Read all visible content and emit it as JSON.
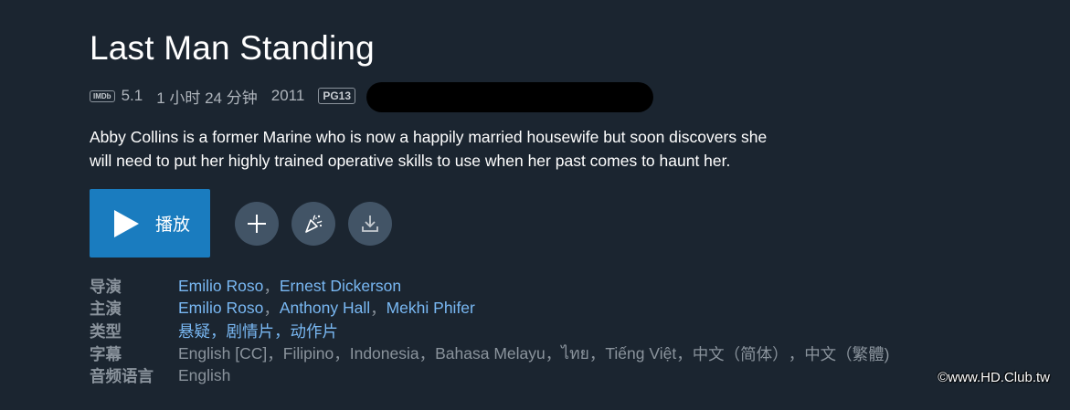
{
  "title": "Last Man Standing",
  "meta": {
    "imdb_badge": "IMDb",
    "imdb_score": "5.1",
    "duration": "1 小时 24 分钟",
    "year": "2011",
    "rating": "PG13"
  },
  "synopsis_line1": "Abby Collins is a former Marine who is now a happily married housewife but soon discovers she",
  "synopsis_line2": "will need to put her highly trained operative skills to use when her past comes to haunt her.",
  "actions": {
    "play_label": "播放",
    "icons": [
      "play-icon",
      "plus-icon",
      "party-icon",
      "download-icon"
    ]
  },
  "details": {
    "directors_label": "导演",
    "directors": [
      "Emilio Roso",
      "Ernest Dickerson"
    ],
    "cast_label": "主演",
    "cast": [
      "Emilio Roso",
      "Anthony Hall",
      "Mekhi Phifer"
    ],
    "genres_label": "类型",
    "genres": [
      "悬疑",
      "剧情片",
      "动作片"
    ],
    "subtitles_label": "字幕",
    "subtitles": [
      "English [CC]",
      "Filipino",
      "Indonesia",
      "Bahasa Melayu",
      "ไทย",
      "Tiếng Việt",
      "中文（简体）",
      "中文（繁體)"
    ],
    "audio_label": "音频语言",
    "audio": "English",
    "separator": "，"
  },
  "watermark": "©www.HD.Club.tw",
  "colors": {
    "background": "#1b2530",
    "accent": "#1a7cbf",
    "link": "#79b8f3",
    "muted": "#8a939c"
  }
}
